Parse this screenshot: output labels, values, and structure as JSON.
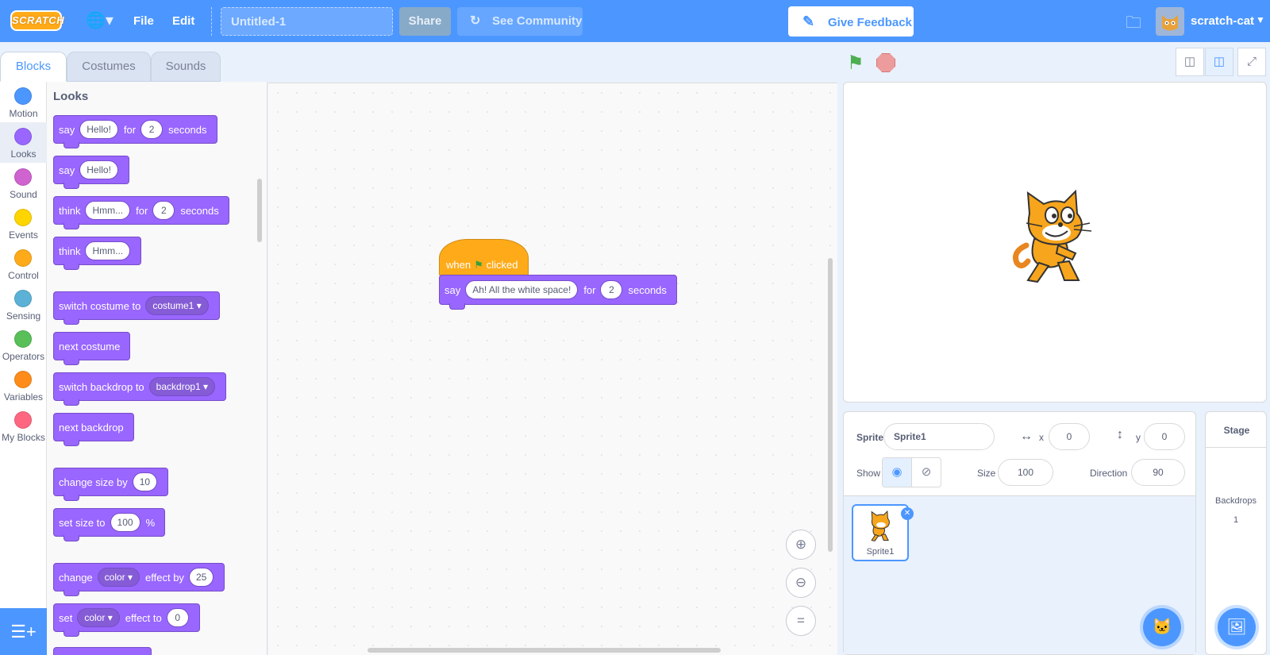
{
  "menubar": {
    "logo": "SCRATCH",
    "language_icon": "globe-icon",
    "file_label": "File",
    "edit_label": "Edit",
    "project_title_placeholder": "Untitled-1",
    "share_label": "Share",
    "see_community_label": "See Community",
    "give_feedback_label": "Give Feedback",
    "username": "scratch-cat"
  },
  "tabs": [
    {
      "label": "Blocks"
    },
    {
      "label": "Costumes"
    },
    {
      "label": "Sounds"
    }
  ],
  "categories": [
    {
      "label": "Motion",
      "color": "#4c97ff"
    },
    {
      "label": "Looks",
      "color": "#9966ff"
    },
    {
      "label": "Sound",
      "color": "#cf63cf"
    },
    {
      "label": "Events",
      "color": "#ffd500"
    },
    {
      "label": "Control",
      "color": "#ffab19"
    },
    {
      "label": "Sensing",
      "color": "#5cb1d6"
    },
    {
      "label": "Operators",
      "color": "#59c059"
    },
    {
      "label": "Variables",
      "color": "#ff8c1a"
    },
    {
      "label": "My Blocks",
      "color": "#ff6680"
    }
  ],
  "palette": {
    "heading": "Looks",
    "blocks": {
      "say_for": {
        "say": "say",
        "msg": "Hello!",
        "for": "for",
        "secs": "2",
        "seconds": "seconds"
      },
      "say": {
        "say": "say",
        "msg": "Hello!"
      },
      "think_for": {
        "think": "think",
        "msg": "Hmm...",
        "for": "for",
        "secs": "2",
        "seconds": "seconds"
      },
      "think": {
        "think": "think",
        "msg": "Hmm..."
      },
      "switch_costume": {
        "text": "switch costume to",
        "value": "costume1"
      },
      "next_costume": {
        "text": "next costume"
      },
      "switch_backdrop": {
        "text": "switch backdrop to",
        "value": "backdrop1"
      },
      "next_backdrop": {
        "text": "next backdrop"
      },
      "change_size": {
        "text": "change size by",
        "value": "10"
      },
      "set_size": {
        "text": "set size to",
        "value": "100",
        "unit": "%"
      },
      "change_effect": {
        "change": "change",
        "effect": "color",
        "by": "effect by",
        "value": "25"
      },
      "set_effect": {
        "set": "set",
        "effect": "color",
        "to": "effect to",
        "value": "0"
      }
    }
  },
  "script": {
    "hat": {
      "when": "when",
      "clicked": "clicked"
    },
    "say": {
      "say": "say",
      "msg": "Ah! All the white space!",
      "for": "for",
      "secs": "2",
      "seconds": "seconds"
    }
  },
  "sprite_info": {
    "sprite_label": "Sprite",
    "sprite_name": "Sprite1",
    "x_label": "x",
    "x_value": "0",
    "y_label": "y",
    "y_value": "0",
    "show_label": "Show",
    "size_label": "Size",
    "size_value": "100",
    "direction_label": "Direction",
    "direction_value": "90"
  },
  "sprites": [
    {
      "name": "Sprite1"
    }
  ],
  "stage_target": {
    "header": "Stage",
    "backdrops_label": "Backdrops",
    "backdrops_count": "1"
  }
}
